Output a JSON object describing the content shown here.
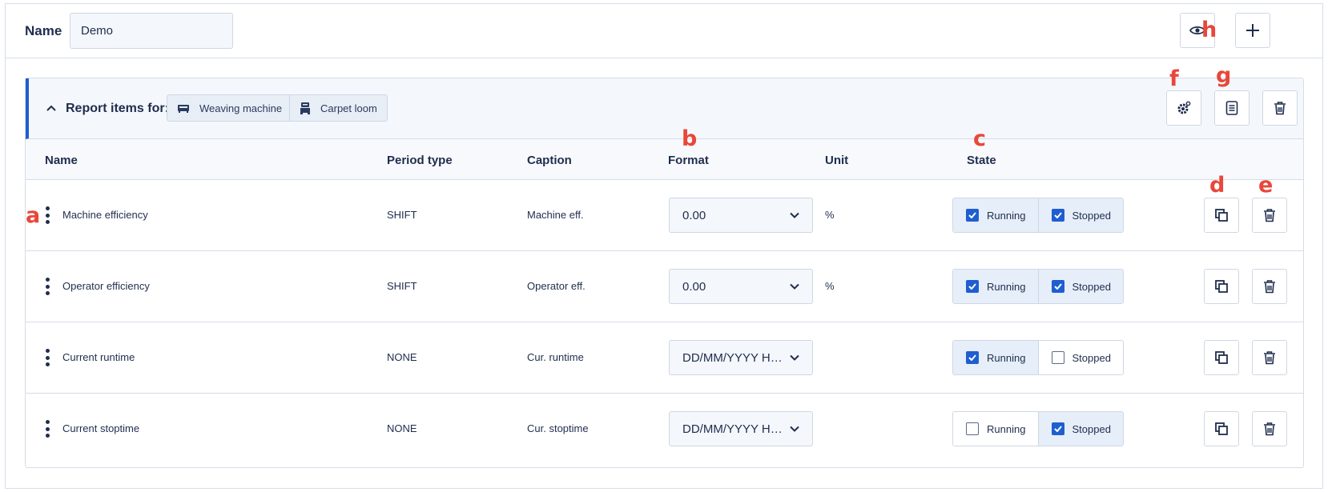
{
  "header": {
    "name_label": "Name",
    "name_value": "Demo"
  },
  "panel": {
    "title": "Report items for:",
    "chips": [
      {
        "label": "Weaving machine",
        "icon": "weaving-machine-icon"
      },
      {
        "label": "Carpet loom",
        "icon": "carpet-loom-icon"
      }
    ]
  },
  "columns": {
    "name": "Name",
    "period_type": "Period type",
    "caption": "Caption",
    "format": "Format",
    "unit": "Unit",
    "state": "State"
  },
  "rows": [
    {
      "name": "Machine efficiency",
      "period_type": "SHIFT",
      "caption": "Machine eff.",
      "format": "0.00",
      "unit": "%",
      "running_label": "Running",
      "running": true,
      "stopped_label": "Stopped",
      "stopped": true
    },
    {
      "name": "Operator efficiency",
      "period_type": "SHIFT",
      "caption": "Operator eff.",
      "format": "0.00",
      "unit": "%",
      "running_label": "Running",
      "running": true,
      "stopped_label": "Stopped",
      "stopped": true
    },
    {
      "name": "Current runtime",
      "period_type": "NONE",
      "caption": "Cur. runtime",
      "format": "DD/MM/YYYY HH:mm:ss",
      "unit": "",
      "running_label": "Running",
      "running": true,
      "stopped_label": "Stopped",
      "stopped": false
    },
    {
      "name": "Current stoptime",
      "period_type": "NONE",
      "caption": "Cur. stoptime",
      "format": "DD/MM/YYYY HH:mm:ss",
      "unit": "",
      "running_label": "Running",
      "running": false,
      "stopped_label": "Stopped",
      "stopped": true
    }
  ],
  "annotations": {
    "a": "a",
    "b": "b",
    "c": "c",
    "d": "d",
    "e": "e",
    "f": "f",
    "g": "g",
    "h": "h"
  },
  "colors": {
    "accent": "#1e5ed0",
    "text": "#1f2d4d",
    "annotation": "#e8473a",
    "border": "#d6dde8"
  }
}
